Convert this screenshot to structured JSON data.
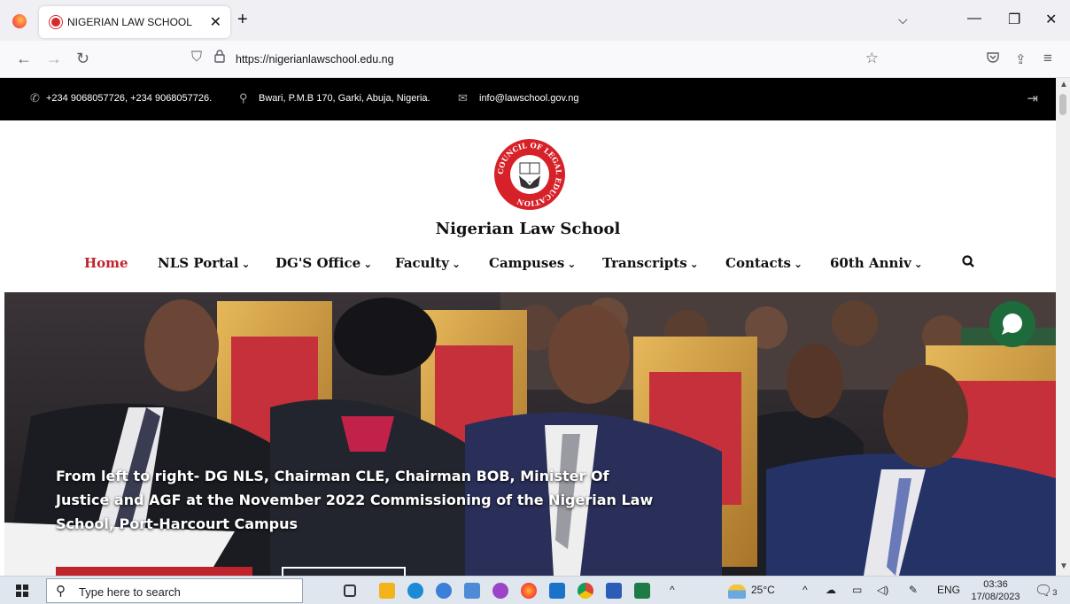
{
  "browser": {
    "tab_title": "NIGERIAN LAW SCHOOL",
    "tab_close": "✕",
    "new_tab": "+",
    "tabs_dropdown": "⌵",
    "minimize": "—",
    "restore": "❐",
    "close": "✕",
    "back": "←",
    "forward": "→",
    "reload": "↻",
    "url_shield": "⛉",
    "url_lock": "🔒",
    "url": "https://nigerianlawschool.edu.ng",
    "bookmark": "☆",
    "pocket": "⛉",
    "extensions": "⇪",
    "menu": "≡"
  },
  "topbar": {
    "phone": "+234 9068057726, +234 9068057726.",
    "address": "Bwari, P.M.B 170, Garki, Abuja, Nigeria.",
    "email": "info@lawschool.gov.ng",
    "phone_icon": "✆",
    "location_icon": "⚲",
    "email_icon": "✉",
    "login_icon": "⇥"
  },
  "site": {
    "title": "Nigerian Law School",
    "logo_text": "COUNCIL OF LEGAL EDUCATION",
    "menu": [
      {
        "label": "Home",
        "dropdown": ""
      },
      {
        "label": "NLS Portal",
        "dropdown": "⌄"
      },
      {
        "label": "DG'S Office",
        "dropdown": "⌄"
      },
      {
        "label": "Faculty",
        "dropdown": "⌄"
      },
      {
        "label": "Campuses",
        "dropdown": "⌄"
      },
      {
        "label": "Transcripts",
        "dropdown": "⌄"
      },
      {
        "label": "Contacts",
        "dropdown": "⌄"
      },
      {
        "label": "60th Anniv",
        "dropdown": "⌄"
      }
    ],
    "search_icon": "🔍"
  },
  "hero": {
    "caption": "From left to right- DG NLS, Chairman CLE, Chairman BOB, Minister Of Justice and AGF at the November 2022 Commissioning of the Nigerian Law School, Port-Harcourt Campus"
  },
  "taskbar": {
    "search_placeholder": "Type here to search",
    "search_icon": "⚲",
    "chevron": "^",
    "weather": "25°C",
    "tray_up": "^",
    "language": "ENG",
    "time": "03:36",
    "date": "17/08/2023",
    "notifications": "3"
  },
  "colors": {
    "accent_red": "#c0232c",
    "topbar_bg": "#000000",
    "chat_green": "#1d6b3a"
  }
}
